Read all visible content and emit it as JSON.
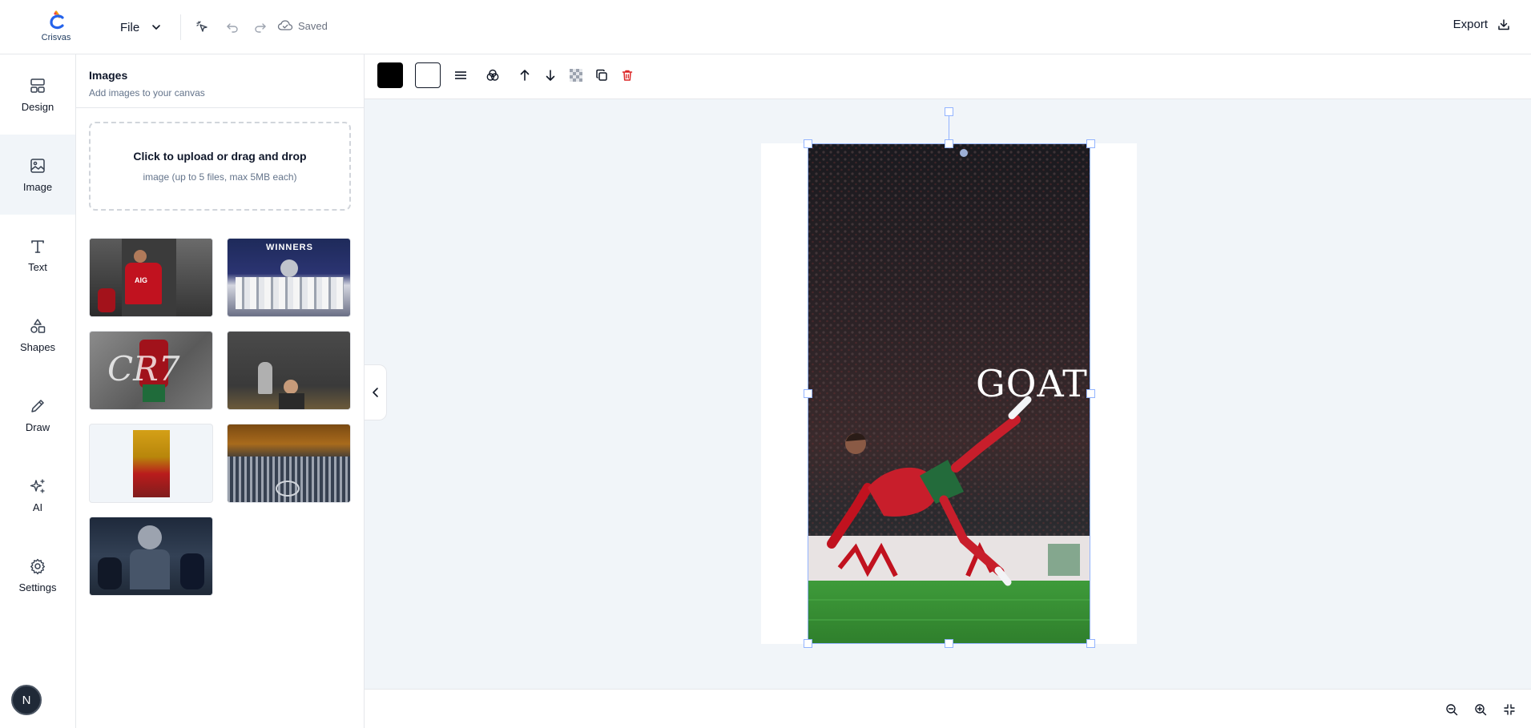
{
  "app": {
    "logo_text": "Crisvas",
    "brand_color": "#2563eb"
  },
  "topbar": {
    "file_label": "File",
    "saved_label": "Saved",
    "export_label": "Export",
    "icons": [
      "pointer-sparkle-icon",
      "undo-icon",
      "redo-icon",
      "cloud-icon",
      "download-icon"
    ]
  },
  "sidebar": {
    "items": [
      {
        "label": "Design",
        "icon": "layout-icon"
      },
      {
        "label": "Image",
        "icon": "image-icon",
        "active": true
      },
      {
        "label": "Text",
        "icon": "text-icon"
      },
      {
        "label": "Shapes",
        "icon": "shapes-icon"
      },
      {
        "label": "Draw",
        "icon": "pencil-icon"
      },
      {
        "label": "AI",
        "icon": "sparkles-icon"
      },
      {
        "label": "Settings",
        "icon": "gear-icon"
      }
    ],
    "badge_letter": "N"
  },
  "panel": {
    "title": "Images",
    "subtitle": "Add images to your canvas",
    "upload_title": "Click to upload or drag and drop",
    "upload_sub": "image (up to 5 files, max 5MB each)",
    "thumbs": [
      {
        "name": "thumb-red-jersey",
        "caption": "AIG"
      },
      {
        "name": "thumb-winners",
        "caption": "WINNERS"
      },
      {
        "name": "thumb-cr7",
        "caption": "CR7"
      },
      {
        "name": "thumb-trophy",
        "caption": ""
      },
      {
        "name": "thumb-celebration",
        "caption": ""
      },
      {
        "name": "thumb-stadium",
        "caption": ""
      },
      {
        "name": "thumb-crowd",
        "caption": ""
      }
    ]
  },
  "canvas_toolbar": {
    "fill_color": "#000000",
    "stroke_color": "#ffffff",
    "icons": [
      "stroke-width-icon",
      "blend-icon",
      "arrow-up-icon",
      "arrow-down-icon",
      "transparency-icon",
      "duplicate-icon",
      "trash-icon"
    ],
    "delete_color": "#dc2626"
  },
  "canvas": {
    "overlay_text": "GOAT",
    "selection_color": "#93b4ff"
  },
  "bottombar": {
    "icons": [
      "zoom-out-icon",
      "zoom-in-icon",
      "fit-screen-icon"
    ]
  }
}
